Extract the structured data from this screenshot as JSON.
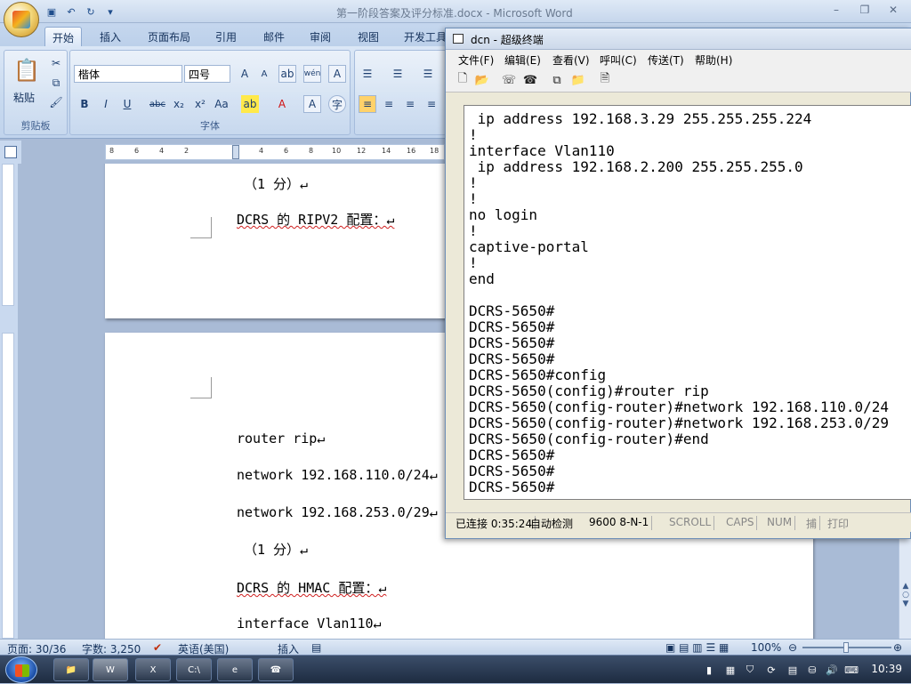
{
  "word": {
    "title": "第一阶段答案及评分标准.docx - Microsoft Word",
    "tabs": [
      "开始",
      "插入",
      "页面布局",
      "引用",
      "邮件",
      "审阅",
      "视图",
      "开发工具"
    ],
    "font_name": "楷体",
    "font_size": "四号",
    "groups": {
      "clipboard": "剪贴板",
      "font": "字体",
      "paste": "粘贴"
    },
    "ruler_ticks": [
      "8",
      "6",
      "4",
      "2",
      "2",
      "4",
      "6",
      "8",
      "10",
      "12",
      "14",
      "16",
      "18"
    ],
    "doc_lines": [
      "（1 分）↵",
      "DCRS 的 RIPV2 配置：↵",
      "router rip↵",
      "network 192.168.110.0/24↵",
      "network 192.168.253.0/29↵",
      "（1 分）↵",
      "DCRS 的 HMAC 配置：↵",
      "interface Vlan110↵"
    ],
    "status": {
      "page": "页面: 30/36",
      "words": "字数: 3,250",
      "language": "英语(美国)",
      "insert": "插入",
      "zoom": "100%"
    }
  },
  "terminal": {
    "title": "dcn - 超级终端",
    "menu": [
      "文件(F)",
      "编辑(E)",
      "查看(V)",
      "呼叫(C)",
      "传送(T)",
      "帮助(H)"
    ],
    "lines": [
      " ip address 192.168.3.29 255.255.255.224",
      "!",
      "interface Vlan110",
      " ip address 192.168.2.200 255.255.255.0",
      "!",
      "!",
      "no login",
      "!",
      "captive-portal",
      "!",
      "end",
      "",
      "DCRS-5650#",
      "DCRS-5650#",
      "DCRS-5650#",
      "DCRS-5650#",
      "DCRS-5650#config",
      "DCRS-5650(config)#router rip",
      "DCRS-5650(config-router)#network 192.168.110.0/24",
      "DCRS-5650(config-router)#network 192.168.253.0/29",
      "DCRS-5650(config-router)#end",
      "DCRS-5650#",
      "DCRS-5650#",
      "DCRS-5650#"
    ],
    "status": [
      "已连接 0:35:24",
      "自动检测",
      "9600 8-N-1",
      "SCROLL",
      "CAPS",
      "NUM",
      "捕",
      "打印"
    ]
  },
  "taskbar": {
    "clock": "10:39"
  }
}
